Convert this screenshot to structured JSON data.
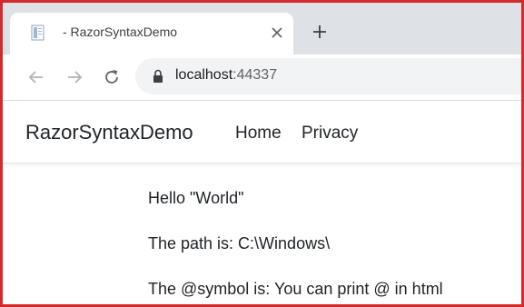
{
  "browser": {
    "tab": {
      "title": "- RazorSyntaxDemo",
      "favicon": "document-icon",
      "close_icon": "close-icon"
    },
    "new_tab_icon": "plus-icon",
    "toolbar": {
      "back_icon": "back-arrow-icon",
      "forward_icon": "forward-arrow-icon",
      "reload_icon": "reload-icon",
      "lock_icon": "lock-icon",
      "url_host": "localhost",
      "url_port": ":44337"
    }
  },
  "site": {
    "brand": "RazorSyntaxDemo",
    "nav": [
      {
        "label": "Home"
      },
      {
        "label": "Privacy"
      }
    ]
  },
  "content": {
    "lines": [
      "Hello \"World\"",
      "The path is: C:\\Windows\\",
      "The @symbol is: You can print @ in html"
    ]
  },
  "colors": {
    "frame_border": "#d62a2a",
    "tabstrip": "#dee1e6",
    "omnibox": "#f1f3f4",
    "text": "#212529"
  }
}
